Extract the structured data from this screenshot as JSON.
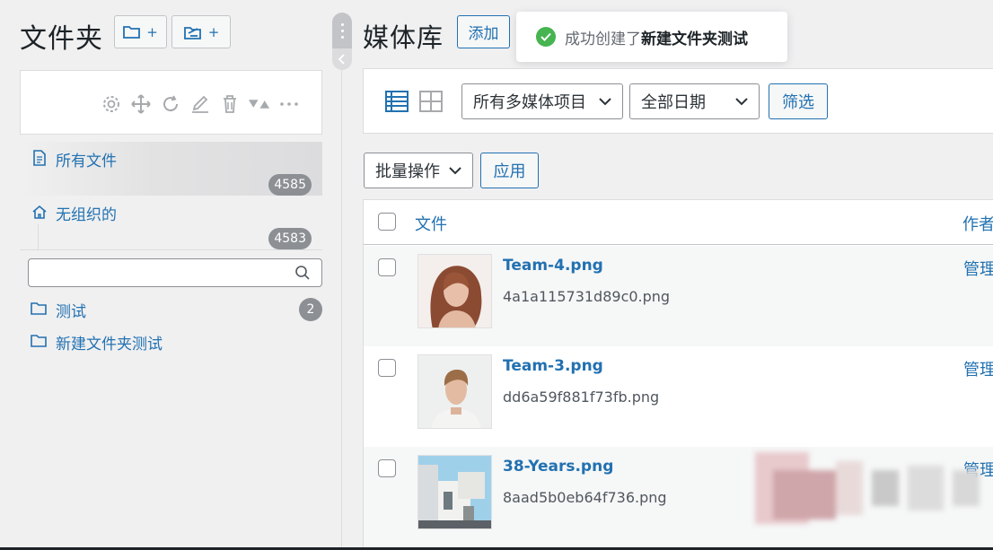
{
  "sidebar": {
    "title": "文件夹",
    "new_folder_btn": "+",
    "new_folder_btn2": "+",
    "tree": [
      {
        "label": "所有文件",
        "count": "4585"
      },
      {
        "label": "无组织的",
        "count": "4583"
      }
    ],
    "search_placeholder": "",
    "folders": [
      {
        "label": "测试",
        "count": "2"
      },
      {
        "label": "新建文件夹测试",
        "count": ""
      }
    ]
  },
  "header": {
    "title": "媒体库",
    "add_label": "添加"
  },
  "toast": {
    "prefix": "成功创建了",
    "folder_name": "新建文件夹测试"
  },
  "filters": {
    "type_select": "所有多媒体项目",
    "date_select": "全部日期",
    "filter_btn": "筛选",
    "bulk_select": "批量操作",
    "apply_btn": "应用"
  },
  "table": {
    "col_file": "文件",
    "col_author": "作者",
    "rows": [
      {
        "title": "Team-4.png",
        "filename": "4a1a115731d89c0.png",
        "author": "管理"
      },
      {
        "title": "Team-3.png",
        "filename": "dd6a59f881f73fb.png",
        "author": "管理"
      },
      {
        "title": "38-Years.png",
        "filename": "8aad5b0eb64f736.png",
        "author": "管理"
      }
    ]
  },
  "colors": {
    "accent": "#2271b1",
    "success": "#46b450",
    "badge": "#8c8f94",
    "background": "#f0f0f1"
  },
  "icons": [
    "folder-plus-icon",
    "folder-upload-icon",
    "gear-icon",
    "move-icon",
    "refresh-icon",
    "edit-icon",
    "trash-icon",
    "sort-icon",
    "more-icon",
    "file-icon",
    "home-icon",
    "search-icon",
    "folder-icon",
    "check-icon",
    "list-view-icon",
    "grid-view-icon",
    "chevron-down-icon"
  ]
}
